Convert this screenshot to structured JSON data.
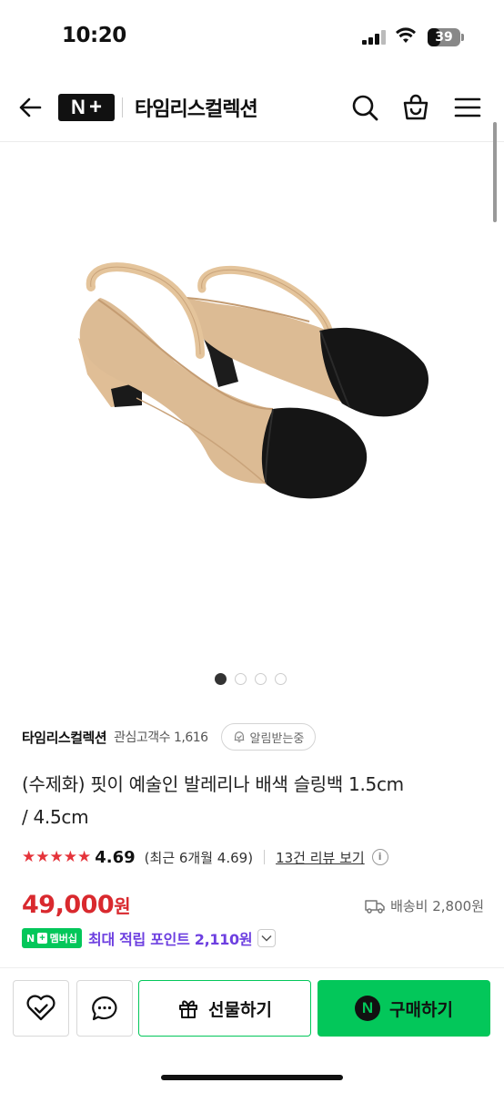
{
  "status_bar": {
    "time": "10:20",
    "battery": "39",
    "battery_level": 0.39
  },
  "header": {
    "logo_text": "N+",
    "store_name": "타임리스컬렉션",
    "icons": [
      "back-arrow-icon",
      "search-icon",
      "shopping-bag-icon",
      "menu-icon"
    ]
  },
  "gallery": {
    "image": "product-shoe-image",
    "page_count": 4,
    "current_page": 1
  },
  "seller": {
    "name": "타임리스컬렉션",
    "fans": "관심고객수 1,616",
    "notify_label": "알림받는중"
  },
  "product": {
    "title_line1": "(수제화) 핏이 예술인 발레리나 배색 슬링백 1.5cm",
    "title_line2": "/ 4.5cm"
  },
  "rating": {
    "stars": 5,
    "score": "4.69",
    "recent": "(최근 6개월 4.69)",
    "reviews": "13건 리뷰 보기"
  },
  "price": {
    "amount": "49,000",
    "unit": "원",
    "shipping": "배송비 2,800원"
  },
  "points": {
    "badge_n": "N",
    "badge_plus": "+",
    "badge_label": "멤버십",
    "text": "최대 적립 포인트 2,110원"
  },
  "actions": {
    "gift_label": "선물하기",
    "buy_label": "구매하기",
    "buy_n": "N"
  },
  "colors": {
    "accent": "#03c75a",
    "price": "#d9292e",
    "point": "#6d3fe0",
    "star": "#e5333a"
  }
}
